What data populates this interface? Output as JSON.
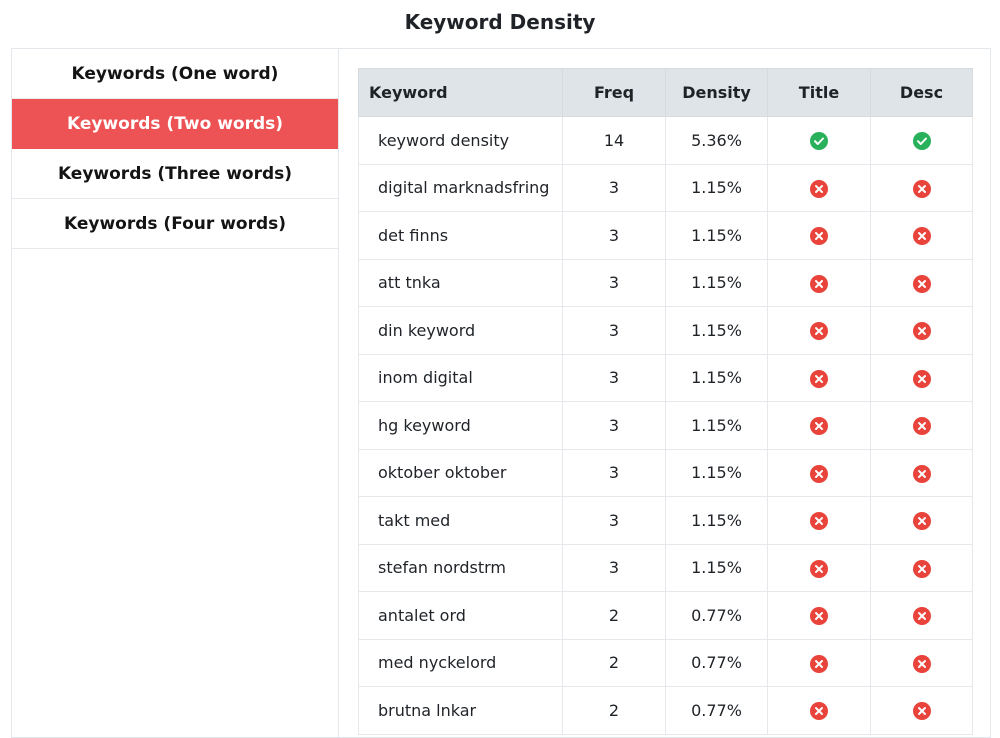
{
  "page": {
    "title": "Keyword Density"
  },
  "sidebar": {
    "items": [
      {
        "label": "Keywords (One word)",
        "active": false
      },
      {
        "label": "Keywords (Two words)",
        "active": true
      },
      {
        "label": "Keywords (Three words)",
        "active": false
      },
      {
        "label": "Keywords (Four words)",
        "active": false
      }
    ]
  },
  "table": {
    "headers": {
      "keyword": "Keyword",
      "freq": "Freq",
      "density": "Density",
      "title": "Title",
      "desc": "Desc"
    },
    "icons": {
      "yes": "check-circle-icon",
      "no": "x-circle-icon"
    },
    "colors": {
      "yes": "#29b05b",
      "no": "#e8443b",
      "active_tab": "#ed5254"
    },
    "rows": [
      {
        "keyword": "keyword density",
        "freq": "14",
        "density": "5.36%",
        "title": true,
        "desc": true
      },
      {
        "keyword": "digital marknadsfring",
        "freq": "3",
        "density": "1.15%",
        "title": false,
        "desc": false
      },
      {
        "keyword": "det finns",
        "freq": "3",
        "density": "1.15%",
        "title": false,
        "desc": false
      },
      {
        "keyword": "att tnka",
        "freq": "3",
        "density": "1.15%",
        "title": false,
        "desc": false
      },
      {
        "keyword": "din keyword",
        "freq": "3",
        "density": "1.15%",
        "title": false,
        "desc": false
      },
      {
        "keyword": "inom digital",
        "freq": "3",
        "density": "1.15%",
        "title": false,
        "desc": false
      },
      {
        "keyword": "hg keyword",
        "freq": "3",
        "density": "1.15%",
        "title": false,
        "desc": false
      },
      {
        "keyword": "oktober oktober",
        "freq": "3",
        "density": "1.15%",
        "title": false,
        "desc": false
      },
      {
        "keyword": "takt med",
        "freq": "3",
        "density": "1.15%",
        "title": false,
        "desc": false
      },
      {
        "keyword": "stefan nordstrm",
        "freq": "3",
        "density": "1.15%",
        "title": false,
        "desc": false
      },
      {
        "keyword": "antalet ord",
        "freq": "2",
        "density": "0.77%",
        "title": false,
        "desc": false
      },
      {
        "keyword": "med nyckelord",
        "freq": "2",
        "density": "0.77%",
        "title": false,
        "desc": false
      },
      {
        "keyword": "brutna lnkar",
        "freq": "2",
        "density": "0.77%",
        "title": false,
        "desc": false
      }
    ]
  }
}
